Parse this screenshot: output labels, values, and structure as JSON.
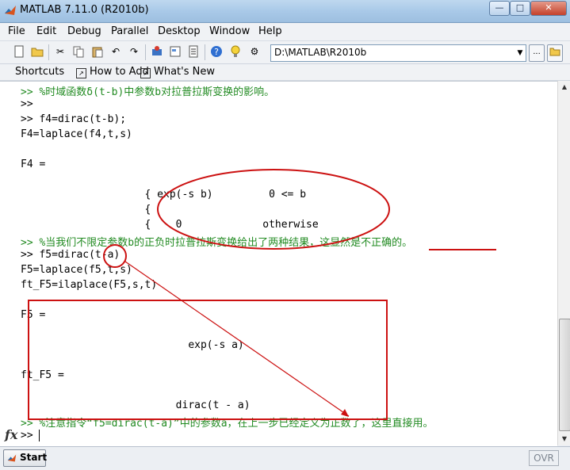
{
  "window": {
    "title": "MATLAB  7.11.0 (R2010b)",
    "min": "—",
    "max": "□",
    "close": "✕"
  },
  "menu": [
    "File",
    "Edit",
    "Debug",
    "Parallel",
    "Desktop",
    "Window",
    "Help"
  ],
  "toolbar": {
    "current_directory": "D:\\MATLAB\\R2010b",
    "browse_label": "...",
    "icons": [
      "new-file-icon",
      "open-folder-icon",
      "cut-icon",
      "copy-icon",
      "paste-icon",
      "undo-icon",
      "redo-icon",
      "simulink-icon",
      "guide-icon",
      "profiler-icon",
      "help-icon",
      "tip-icon",
      "settings-icon"
    ]
  },
  "shortcuts": {
    "label": "Shortcuts",
    "items": [
      "How to Add",
      "What's New"
    ]
  },
  "command_window": {
    "lines": [
      ">> %时域函数δ(t-b)中参数b对拉普拉斯变换的影响。",
      ">>",
      ">> f4=dirac(t-b);",
      "F4=laplace(f4,t,s)",
      "",
      "F4 =",
      "",
      "                    { exp(-s b)         0 <= b",
      "                    {",
      "                    {    0             otherwise",
      ">> %当我们不限定参数b的正负时拉普拉斯变换给出了两种结果，这显然是不正确的。",
      ">> f5=dirac(t-a)",
      "F5=laplace(f5,t,s)",
      "ft_F5=ilaplace(F5,s,t)",
      "",
      "F5 =",
      "",
      "                           exp(-s a)",
      "",
      "",
      "ft_F5 =",
      "",
      "                         dirac(t - a)",
      ">> %注意指令“f5=dirac(t-a)”中的参数a，在上一步已经定义为正数了，这里直接用。"
    ],
    "prompt": ">> ",
    "fx_label": "fx"
  },
  "status": {
    "start": "Start",
    "ovr": "OVR"
  },
  "colors": {
    "comment": "#228b22",
    "annotation": "#cc1111"
  }
}
